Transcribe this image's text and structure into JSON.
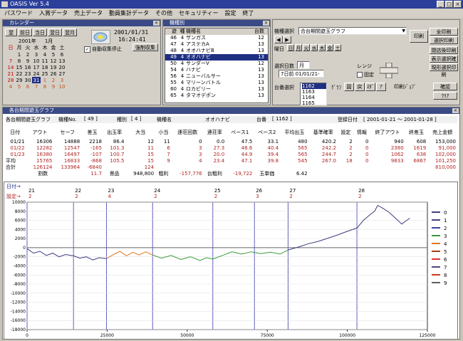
{
  "app": {
    "title": "OASIS Ver 5.4"
  },
  "window_buttons": [
    "_",
    "□",
    "×"
  ],
  "menu": [
    "パスワード",
    "入賞データ",
    "売上データ",
    "動員集計データ",
    "その他",
    "セキュリティー",
    "設定",
    "終了"
  ],
  "calendar": {
    "title": "カレンダー",
    "nav": [
      "翌",
      "前日",
      "当日",
      "翌日",
      "翌月"
    ],
    "year": "2001年",
    "month": "1月",
    "weekdays": [
      "日",
      "月",
      "火",
      "水",
      "木",
      "金",
      "土"
    ],
    "weeks": [
      [
        "",
        "1",
        "2",
        "3",
        "4",
        "5",
        "6"
      ],
      [
        "7",
        "8",
        "9",
        "10",
        "11",
        "12",
        "13"
      ],
      [
        "14",
        "15",
        "16",
        "17",
        "18",
        "19",
        "20"
      ],
      [
        "21",
        "22",
        "23",
        "24",
        "25",
        "26",
        "27"
      ],
      [
        "28",
        "29",
        "30",
        "31",
        "1",
        "2",
        "3"
      ],
      [
        "4",
        "5",
        "6",
        "7",
        "8",
        "9",
        "10"
      ]
    ],
    "selected": "31",
    "date": "2001/01/31",
    "time": "16:24:41",
    "checkbox_label": "自動収集停止",
    "force_button": "強制収集"
  },
  "machine_list": {
    "title": "機種別",
    "headers": [
      "遊",
      "種",
      "機種名",
      "台数"
    ],
    "rows": [
      [
        "46",
        "4",
        "ザンガス",
        "12"
      ],
      [
        "47",
        "4",
        "アステカA",
        "13"
      ],
      [
        "48",
        "4",
        "オオハナビB",
        "13"
      ],
      [
        "49",
        "4",
        "オオハナビ",
        "13"
      ],
      [
        "50",
        "4",
        "サンダーV",
        "12"
      ],
      [
        "54",
        "4",
        "ハナビ",
        "13"
      ],
      [
        "56",
        "4",
        "ニューバルサー",
        "13"
      ],
      [
        "55",
        "4",
        "マリーンバトル",
        "13"
      ],
      [
        "60",
        "4",
        "ロカビリー",
        "13"
      ],
      [
        "65",
        "4",
        "タマオデポン",
        "13"
      ]
    ],
    "selected_index": 3
  },
  "graph_select": {
    "label": "機種選択",
    "value": "合台期間遊玉グラフ",
    "day_label": "曜日",
    "days": [
      "日",
      "月",
      "火",
      "水",
      "木",
      "金",
      "土"
    ],
    "period_label": "選択日数",
    "period_value": "月",
    "date_range": "7日前 01/01/21-",
    "range_label": "レンジ",
    "fixed_label": "固定",
    "machine_select_label": "台番選択",
    "machine_numbers": [
      "1162",
      "1163",
      "1164",
      "1165"
    ],
    "graph_label": "ｸﾞﾗﾌ",
    "graph_buttons": [
      "図",
      "戻",
      "ｽﾀﾞ",
      "ｱ"
    ],
    "print_label": "印刷ｼﾞｮﾌﾞ",
    "print_buttons": [
      "確認",
      "ｸﾘｱ"
    ],
    "print_button": "印刷",
    "buttons": [
      "全印刷",
      "選択印刷",
      "閉店後印刷",
      "表示選択確認",
      "現形選択印刷"
    ]
  },
  "data_panel": {
    "title": "各台期間遊玉グラフ",
    "machine_no_label": "機種No.",
    "machine_no": "[ 49 ]",
    "type_label": "種別",
    "type": "[ 4 ]",
    "name_label": "機種名",
    "name": "オオハナビ",
    "unit_label": "台番",
    "unit": "[ 1162 ]",
    "period_label": "登録日付",
    "period": "[ 2001-01-21 〜 2001-01-28 ]",
    "headers": [
      "日付",
      "アウト",
      "セーフ",
      "差玉",
      "出玉率",
      "大当",
      "小当",
      "連荘回数",
      "連荘率",
      "ベース1",
      "ベース2",
      "平均出玉",
      "基準確率",
      "設定",
      "情報",
      "終了アウト",
      "終差玉",
      "売上金額"
    ],
    "rows": [
      {
        "red": false,
        "cells": [
          "01/21",
          "16306",
          "14888",
          "2218",
          "86.4",
          "12",
          "11",
          "0",
          "0.0",
          "47.5",
          "33.1",
          "480",
          "420.2",
          "2",
          "0",
          "940",
          "608",
          "153,000"
        ]
      },
      {
        "red": true,
        "cells": [
          "01/22",
          "12282",
          "12547",
          "-165",
          "101.3",
          "11",
          "6",
          "3",
          "27.3",
          "46.6",
          "40.4",
          "565",
          "242.2",
          "2",
          "0",
          "2380",
          "1619",
          "91,000"
        ]
      },
      {
        "red": true,
        "cells": [
          "01/23",
          "16380",
          "16497",
          "-107",
          "100.7",
          "15",
          "7",
          "3",
          "20.0",
          "44.9",
          "39.4",
          "565",
          "244.7",
          "2",
          "0",
          "1062",
          "638",
          "102,000"
        ]
      }
    ],
    "avg_label": "平均",
    "avg": [
      "15765",
      "16833",
      "-868",
      "105.5",
      "15",
      "9",
      "4",
      "23.4",
      "47.1",
      "39.8",
      "545",
      "267.0",
      "18",
      "0",
      "9833",
      "6867",
      "101,250"
    ],
    "total_label": "合計",
    "total": [
      "126124",
      "133964",
      "-6840",
      "",
      "124",
      "",
      "",
      "",
      "",
      "",
      "",
      "",
      "",
      "",
      "",
      "",
      "810,000"
    ],
    "summary": [
      "割数",
      "11.7",
      "景品",
      "948,800",
      "粗利",
      "-157,776",
      "台粗利",
      "-19,722",
      "玉単価",
      "6.42"
    ]
  },
  "chart_data": {
    "type": "line",
    "day_label": "日付→",
    "setting_label": "設定→",
    "day_markers": [
      {
        "day": "21",
        "setting": "2",
        "x": 0
      },
      {
        "day": "22",
        "setting": "2",
        "x": 14500
      },
      {
        "day": "23",
        "setting": "4",
        "x": 24800
      },
      {
        "day": "24",
        "setting": "2",
        "x": 39200
      },
      {
        "day": "25",
        "setting": "2",
        "x": 58000
      },
      {
        "day": "26",
        "setting": "3",
        "x": 71000
      },
      {
        "day": "27",
        "setting": "2",
        "x": 81500
      },
      {
        "day": "28",
        "setting": "2",
        "x": 103000
      }
    ],
    "xlim": [
      0,
      125000
    ],
    "ylim": [
      -18000,
      10000
    ],
    "xticks": [
      "0",
      "25000",
      "50000",
      "75000",
      "100000",
      "125000"
    ],
    "yticks": [
      "10000",
      "8000",
      "6000",
      "4000",
      "2000",
      "0",
      "-2000",
      "-4000",
      "-6000",
      "-8000",
      "-10000",
      "-12000",
      "-14000",
      "-16000",
      "-18000"
    ],
    "legend": [
      "0",
      "1",
      "2",
      "3",
      "4",
      "5",
      "6",
      "7",
      "8",
      "9"
    ],
    "legend_colors": [
      "#404080",
      "#404080",
      "#4040a0",
      "#3a9a3a",
      "#e07820",
      "#a04010",
      "#e03030",
      "#4a4a80",
      "#c04020",
      "#606060"
    ],
    "series": [
      {
        "color": "#3a3a80",
        "points": [
          [
            0,
            -200
          ],
          [
            2000,
            -1200
          ],
          [
            4000,
            -800
          ],
          [
            6000,
            -1700
          ],
          [
            8000,
            -1200
          ],
          [
            10000,
            -2000
          ],
          [
            12000,
            -1500
          ],
          [
            14500,
            -1800
          ]
        ]
      },
      {
        "color": "#3a3a80",
        "points": [
          [
            14500,
            -1800
          ],
          [
            16500,
            -2300
          ],
          [
            18500,
            -2000
          ],
          [
            20500,
            -2700
          ],
          [
            22500,
            -2200
          ],
          [
            24800,
            -2400
          ]
        ]
      },
      {
        "color": "#e07820",
        "points": [
          [
            24800,
            -2400
          ],
          [
            27000,
            -1500
          ],
          [
            29000,
            -800
          ],
          [
            31000,
            -1800
          ],
          [
            33000,
            -1000
          ],
          [
            35000,
            -1600
          ],
          [
            37000,
            -900
          ],
          [
            39200,
            -1600
          ]
        ]
      },
      {
        "color": "#3a9a3a",
        "points": [
          [
            39200,
            -1600
          ],
          [
            42000,
            -2300
          ],
          [
            45000,
            -1700
          ],
          [
            48000,
            -2600
          ],
          [
            51000,
            -2000
          ],
          [
            54000,
            -2800
          ],
          [
            56000,
            -2200
          ],
          [
            58000,
            -2500
          ]
        ]
      },
      {
        "color": "#3a9a3a",
        "points": [
          [
            58000,
            -2500
          ],
          [
            61000,
            -1700
          ],
          [
            64000,
            -900
          ],
          [
            67000,
            -1400
          ],
          [
            70000,
            -900
          ],
          [
            73000,
            -1300
          ],
          [
            76000,
            -1000
          ],
          [
            79000,
            -1400
          ],
          [
            81500,
            -500
          ]
        ]
      },
      {
        "color": "#3a3a80",
        "points": [
          [
            81500,
            -500
          ],
          [
            85000,
            200
          ],
          [
            88000,
            900
          ],
          [
            91000,
            1400
          ],
          [
            94000,
            2100
          ],
          [
            97000,
            2800
          ],
          [
            100000,
            3600
          ],
          [
            103000,
            4300
          ]
        ]
      },
      {
        "color": "#3a3a80",
        "points": [
          [
            103000,
            4300
          ],
          [
            105000,
            6000
          ],
          [
            107000,
            7200
          ],
          [
            108500,
            8000
          ],
          [
            109500,
            9300
          ],
          [
            111000,
            8700
          ],
          [
            113000,
            7800
          ],
          [
            115000,
            6500
          ],
          [
            117000,
            5200
          ],
          [
            118500,
            6000
          ],
          [
            119500,
            6500
          ]
        ]
      }
    ]
  }
}
